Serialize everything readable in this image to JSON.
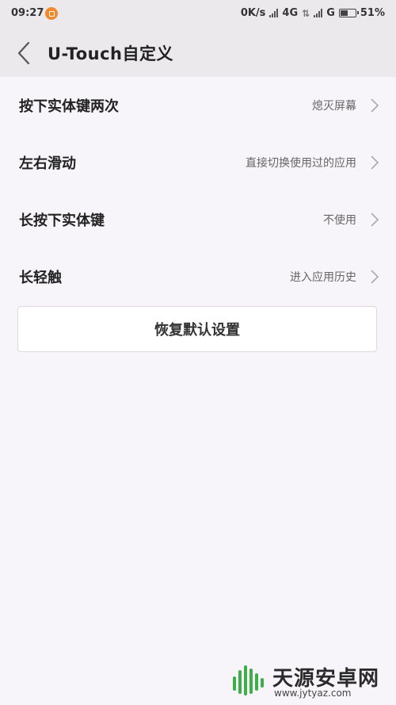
{
  "status_bar": {
    "time": "09:27",
    "network_speed": "0K/s",
    "network_type": "4G",
    "network_type_2": "G",
    "battery_percent": "51%",
    "battery_level": 0.51
  },
  "header": {
    "title": "U-Touch自定义"
  },
  "settings": [
    {
      "label": "按下实体键两次",
      "value": "熄灭屏幕"
    },
    {
      "label": "左右滑动",
      "value": "直接切换使用过的应用"
    },
    {
      "label": "长按下实体键",
      "value": "不使用"
    },
    {
      "label": "长轻触",
      "value": "进入应用历史"
    }
  ],
  "reset_button": "恢复默认设置",
  "watermark": {
    "title": "天源安卓网",
    "url": "www.jytyaz.com",
    "color": "#3fae49"
  }
}
